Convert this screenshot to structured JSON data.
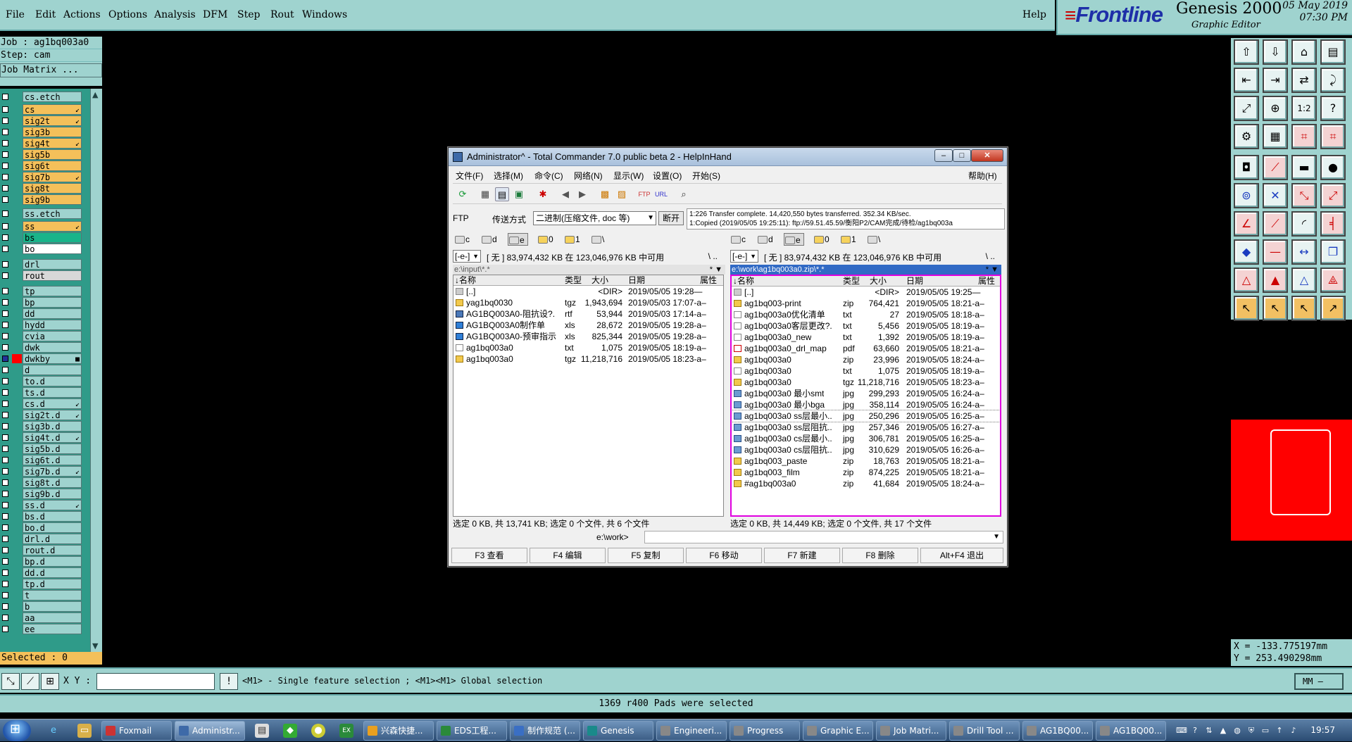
{
  "menubar": {
    "items": [
      "File",
      "Edit",
      "Actions",
      "Options",
      "Analysis",
      "DFM",
      "Step",
      "Rout",
      "Windows"
    ],
    "help": "Help"
  },
  "branding": {
    "brand": "Frontline",
    "product": "Genesis 2000",
    "subtitle": "Graphic Editor",
    "date": "05 May 2019",
    "time": "07:30 PM"
  },
  "job": {
    "job_line": "Job : ag1bq003a0",
    "step_line": "Step: cam",
    "matrix_button": "Job Matrix ..."
  },
  "layers": [
    {
      "name": "cs.etch",
      "color": "#9fd3cf",
      "mark": ""
    },
    {
      "name": "cs",
      "color": "#f4c05a",
      "mark": "↙"
    },
    {
      "name": "sig2t",
      "color": "#f4c05a",
      "mark": "↙"
    },
    {
      "name": "sig3b",
      "color": "#f4c05a",
      "mark": ""
    },
    {
      "name": "sig4t",
      "color": "#f4c05a",
      "mark": "↙"
    },
    {
      "name": "sig5b",
      "color": "#f4c05a",
      "mark": ""
    },
    {
      "name": "sig6t",
      "color": "#f4c05a",
      "mark": ""
    },
    {
      "name": "sig7b",
      "color": "#f4c05a",
      "mark": "↙"
    },
    {
      "name": "sig8t",
      "color": "#f4c05a",
      "mark": ""
    },
    {
      "name": "sig9b",
      "color": "#f4c05a",
      "mark": ""
    },
    {
      "name": "ss.etch",
      "color": "#9fd3cf",
      "mark": ""
    },
    {
      "name": "ss",
      "color": "#f4c05a",
      "mark": "↙"
    },
    {
      "name": "bs",
      "color": "#19b48a",
      "mark": ""
    },
    {
      "name": "bo",
      "color": "#ffffff",
      "mark": ""
    },
    {
      "name": "drl",
      "color": "#9fd3cf",
      "mark": ""
    },
    {
      "name": "rout",
      "color": "#d8d8d8",
      "mark": ""
    },
    {
      "name": "tp",
      "color": "#9fd3cf",
      "mark": ""
    },
    {
      "name": "bp",
      "color": "#9fd3cf",
      "mark": ""
    },
    {
      "name": "dd",
      "color": "#9fd3cf",
      "mark": ""
    },
    {
      "name": "hydd",
      "color": "#9fd3cf",
      "mark": ""
    },
    {
      "name": "cvia",
      "color": "#9fd3cf",
      "mark": ""
    },
    {
      "name": "dwk",
      "color": "#9fd3cf",
      "mark": ""
    },
    {
      "name": "dwkby",
      "color": "#9fd3cf",
      "mark": "■"
    },
    {
      "name": "d",
      "color": "#9fd3cf",
      "mark": ""
    },
    {
      "name": "to.d",
      "color": "#9fd3cf",
      "mark": ""
    },
    {
      "name": "ts.d",
      "color": "#9fd3cf",
      "mark": ""
    },
    {
      "name": "cs.d",
      "color": "#9fd3cf",
      "mark": "↙"
    },
    {
      "name": "sig2t.d",
      "color": "#9fd3cf",
      "mark": "↙"
    },
    {
      "name": "sig3b.d",
      "color": "#9fd3cf",
      "mark": ""
    },
    {
      "name": "sig4t.d",
      "color": "#9fd3cf",
      "mark": "↙"
    },
    {
      "name": "sig5b.d",
      "color": "#9fd3cf",
      "mark": ""
    },
    {
      "name": "sig6t.d",
      "color": "#9fd3cf",
      "mark": ""
    },
    {
      "name": "sig7b.d",
      "color": "#9fd3cf",
      "mark": "↙"
    },
    {
      "name": "sig8t.d",
      "color": "#9fd3cf",
      "mark": ""
    },
    {
      "name": "sig9b.d",
      "color": "#9fd3cf",
      "mark": ""
    },
    {
      "name": "ss.d",
      "color": "#9fd3cf",
      "mark": "↙"
    },
    {
      "name": "bs.d",
      "color": "#9fd3cf",
      "mark": ""
    },
    {
      "name": "bo.d",
      "color": "#9fd3cf",
      "mark": ""
    },
    {
      "name": "drl.d",
      "color": "#9fd3cf",
      "mark": ""
    },
    {
      "name": "rout.d",
      "color": "#9fd3cf",
      "mark": ""
    },
    {
      "name": "bp.d",
      "color": "#9fd3cf",
      "mark": ""
    },
    {
      "name": "dd.d",
      "color": "#9fd3cf",
      "mark": ""
    },
    {
      "name": "tp.d",
      "color": "#9fd3cf",
      "mark": ""
    },
    {
      "name": "t",
      "color": "#9fd3cf",
      "mark": ""
    },
    {
      "name": "b",
      "color": "#9fd3cf",
      "mark": ""
    },
    {
      "name": "aa",
      "color": "#9fd3cf",
      "mark": ""
    },
    {
      "name": "ee",
      "color": "#9fd3cf",
      "mark": ""
    }
  ],
  "selected_count": "Selected : 0",
  "coords": {
    "x": "X = -133.775197mm",
    "y": "Y = 253.490298mm"
  },
  "cmdbar": {
    "xy_label": "X Y :",
    "xy_value": "",
    "hint": "<M1> - Single feature selection ; <M1><M1> Global selection",
    "units": "MM"
  },
  "status_message": "1369 r400 Pads were selected",
  "tc": {
    "title": "Administrator^ - Total Commander 7.0 public beta 2 - HelpInHand",
    "menu": [
      "文件(F)",
      "选择(M)",
      "命令(C)",
      "网络(N)",
      "显示(W)",
      "设置(O)",
      "开始(S)"
    ],
    "help_menu": "帮助(H)",
    "ftp_label": "FTP",
    "transfer_label": "传送方式",
    "transfer_mode": "二进制(压缩文件, doc 等)",
    "disconnect": "断开",
    "log_lines": [
      "1:226 Transfer complete. 14,420,550 bytes transferred. 352.34 KB/sec.",
      "1:Copied (2019/05/05 19:25:11): ftp://59.51.45.59/衡阳P2/CAM完成/待检/ag1bq003a"
    ],
    "left": {
      "drives": [
        "c",
        "d",
        "e",
        "0",
        "1",
        "\\"
      ],
      "drive_combo": "[-e-]",
      "free_text": "[ 无 ]  83,974,432 KB 在 123,046,976 KB 中可用",
      "root_btns": "\\  ..",
      "path": "e:\\input\\*.*",
      "headers": {
        "name": "↓名称",
        "type": "类型",
        "size": "大小",
        "date": "日期",
        "attr": "属性"
      },
      "files": [
        {
          "name": "[..]",
          "type": "",
          "size": "<DIR>",
          "date": "2019/05/05 19:28—",
          "icon": "up"
        },
        {
          "name": "yag1bq0030",
          "type": "tgz",
          "size": "1,943,694",
          "date": "2019/05/03 17:07-a–",
          "icon": "tgz"
        },
        {
          "name": "AG1BQ003A0-阻抗设?.",
          "type": "rtf",
          "size": "53,944",
          "date": "2019/05/03 17:14-a–",
          "icon": "rtf"
        },
        {
          "name": "AG1BQ003A0制作单",
          "type": "xls",
          "size": "28,672",
          "date": "2019/05/05 19:28-a–",
          "icon": "xls"
        },
        {
          "name": "AG1BQ003A0-预审指示",
          "type": "xls",
          "size": "825,344",
          "date": "2019/05/05 19:28-a–",
          "icon": "xls"
        },
        {
          "name": "ag1bq003a0",
          "type": "txt",
          "size": "1,075",
          "date": "2019/05/05 18:19-a–",
          "icon": "txt"
        },
        {
          "name": "ag1bq003a0",
          "type": "tgz",
          "size": "11,218,716",
          "date": "2019/05/05 18:23-a–",
          "icon": "tgz"
        }
      ],
      "status": "选定 0 KB, 共 13,741 KB; 选定 0 个文件, 共 6 个文件"
    },
    "right": {
      "drives": [
        "c",
        "d",
        "e",
        "0",
        "1",
        "\\"
      ],
      "drive_combo": "[-e-]",
      "free_text": "[ 无 ]  83,974,432 KB 在 123,046,976 KB 中可用",
      "root_btns": "\\  ..",
      "path": "e:\\work\\ag1bq003a0.zip\\*.*",
      "headers": {
        "name": "↓名称",
        "type": "类型",
        "size": "大小",
        "date": "日期",
        "attr": "属性"
      },
      "files": [
        {
          "name": "[..]",
          "type": "",
          "size": "<DIR>",
          "date": "2019/05/05 19:25—",
          "icon": "up"
        },
        {
          "name": "ag1bq003-print",
          "type": "zip",
          "size": "764,421",
          "date": "2019/05/05 18:21-a–",
          "icon": "zip"
        },
        {
          "name": "ag1bq003a0优化清单",
          "type": "txt",
          "size": "27",
          "date": "2019/05/05 18:18-a–",
          "icon": "txt"
        },
        {
          "name": "ag1bq003a0客层更改?.",
          "type": "txt",
          "size": "5,456",
          "date": "2019/05/05 18:19-a–",
          "icon": "txt"
        },
        {
          "name": "ag1bq003a0_new",
          "type": "txt",
          "size": "1,392",
          "date": "2019/05/05 18:19-a–",
          "icon": "txt"
        },
        {
          "name": "ag1bq003a0_drl_map",
          "type": "pdf",
          "size": "63,660",
          "date": "2019/05/05 18:21-a–",
          "icon": "pdf"
        },
        {
          "name": "ag1bq003a0",
          "type": "zip",
          "size": "23,996",
          "date": "2019/05/05 18:24-a–",
          "icon": "zip"
        },
        {
          "name": "ag1bq003a0",
          "type": "txt",
          "size": "1,075",
          "date": "2019/05/05 18:19-a–",
          "icon": "txt"
        },
        {
          "name": "ag1bq003a0",
          "type": "tgz",
          "size": "11,218,716",
          "date": "2019/05/05 18:23-a–",
          "icon": "tgz"
        },
        {
          "name": "ag1bq003a0 最小smt",
          "type": "jpg",
          "size": "299,293",
          "date": "2019/05/05 16:24-a–",
          "icon": "jpg"
        },
        {
          "name": "ag1bq003a0 最小bga",
          "type": "jpg",
          "size": "358,114",
          "date": "2019/05/05 16:24-a–",
          "icon": "jpg"
        },
        {
          "name": "ag1bq003a0 ss层最小..",
          "type": "jpg",
          "size": "250,296",
          "date": "2019/05/05 16:25-a–",
          "icon": "jpg"
        },
        {
          "name": "ag1bq003a0 ss层阻抗..",
          "type": "jpg",
          "size": "257,346",
          "date": "2019/05/05 16:27-a–",
          "icon": "jpg"
        },
        {
          "name": "ag1bq003a0 cs层最小..",
          "type": "jpg",
          "size": "306,781",
          "date": "2019/05/05 16:25-a–",
          "icon": "jpg"
        },
        {
          "name": "ag1bq003a0 cs层阻抗..",
          "type": "jpg",
          "size": "310,629",
          "date": "2019/05/05 16:26-a–",
          "icon": "jpg"
        },
        {
          "name": "ag1bq003_paste",
          "type": "zip",
          "size": "18,763",
          "date": "2019/05/05 18:21-a–",
          "icon": "zip"
        },
        {
          "name": "ag1bq003_film",
          "type": "zip",
          "size": "874,225",
          "date": "2019/05/05 18:21-a–",
          "icon": "zip"
        },
        {
          "name": "#ag1bq003a0",
          "type": "zip",
          "size": "41,684",
          "date": "2019/05/05 18:24-a–",
          "icon": "zip"
        }
      ],
      "status": "选定 0 KB, 共 14,449 KB; 选定 0 个文件, 共 17 个文件"
    },
    "cmd_path": "e:\\work>",
    "fkeys": [
      "F3 查看",
      "F4 编辑",
      "F5 复制",
      "F6 移动",
      "F7 新建",
      "F8 删除",
      "Alt+F4 退出"
    ]
  },
  "taskbar": {
    "tasks": [
      {
        "label": "Foxmail",
        "color": "#c33"
      },
      {
        "label": "Administr...",
        "color": "#3e6aa8",
        "active": true
      },
      {
        "label": "兴森快捷...",
        "color": "#e8a020"
      },
      {
        "label": "EDS工程...",
        "color": "#2a8a3a"
      },
      {
        "label": "制作规范 (...",
        "color": "#3a6fc4"
      },
      {
        "label": "Genesis",
        "color": "#1a8a8a"
      },
      {
        "label": "Engineeri...",
        "color": "#888"
      },
      {
        "label": "Progress",
        "color": "#888"
      },
      {
        "label": "Graphic E...",
        "color": "#888"
      },
      {
        "label": "Job Matri...",
        "color": "#888"
      },
      {
        "label": "Drill Tool ...",
        "color": "#888"
      },
      {
        "label": "AG1BQ00...",
        "color": "#888"
      },
      {
        "label": "AG1BQ00...",
        "color": "#888"
      }
    ],
    "clock": "19:57"
  }
}
